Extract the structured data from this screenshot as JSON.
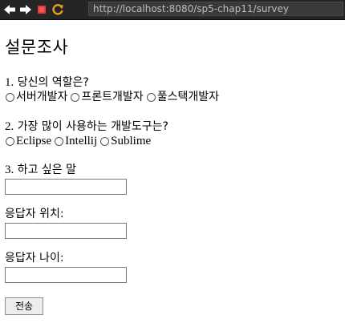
{
  "browser": {
    "url": "http://localhost:8080/sp5-chap11/survey",
    "icons": [
      "back-arrow-icon",
      "forward-arrow-icon",
      "stop-icon",
      "reload-icon"
    ]
  },
  "page": {
    "title": "설문조사"
  },
  "questions": [
    {
      "number": "1.",
      "text": "당신의 역할은?",
      "options": [
        "서버개발자",
        "프론트개발자",
        "풀스택개발자"
      ]
    },
    {
      "number": "2.",
      "text": "가장 많이 사용하는 개발도구는?",
      "options": [
        "Eclipse",
        "Intellij",
        "Sublime"
      ]
    },
    {
      "number": "3.",
      "text": "하고 싶은 말",
      "value": ""
    }
  ],
  "fields": {
    "location_label": "응답자 위치:",
    "location_value": "",
    "age_label": "응답자 나이:",
    "age_value": ""
  },
  "submit_label": "전송",
  "colors": {
    "toolbar_bg": "#252525",
    "back_forward_icon": "#ffffff",
    "stop_icon": "#e83a3a",
    "reload_icon": "#e8a020",
    "url_text": "#bdbdbd"
  }
}
